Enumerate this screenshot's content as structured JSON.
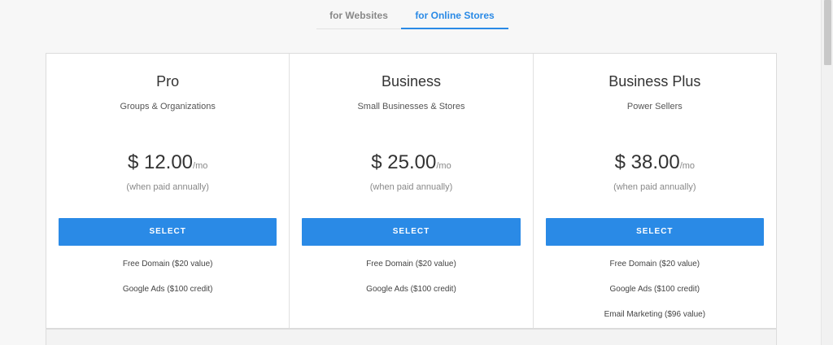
{
  "tabs": [
    {
      "label": "for Websites",
      "active": false
    },
    {
      "label": "for Online Stores",
      "active": true
    }
  ],
  "plans": [
    {
      "name": "Pro",
      "tagline": "Groups & Organizations",
      "price": "$ 12.00",
      "per": "/mo",
      "note": "(when paid annually)",
      "button": "SELECT",
      "features": [
        "Free Domain ($20 value)",
        "Google Ads ($100 credit)"
      ]
    },
    {
      "name": "Business",
      "tagline": "Small Businesses & Stores",
      "price": "$ 25.00",
      "per": "/mo",
      "note": "(when paid annually)",
      "button": "SELECT",
      "features": [
        "Free Domain ($20 value)",
        "Google Ads ($100 credit)"
      ]
    },
    {
      "name": "Business Plus",
      "tagline": "Power Sellers",
      "price": "$ 38.00",
      "per": "/mo",
      "note": "(when paid annually)",
      "button": "SELECT",
      "features": [
        "Free Domain ($20 value)",
        "Google Ads ($100 credit)",
        "Email Marketing ($96 value)"
      ]
    }
  ],
  "colors": {
    "accent": "#2a8ae6",
    "text": "#333333",
    "muted": "#888888"
  }
}
